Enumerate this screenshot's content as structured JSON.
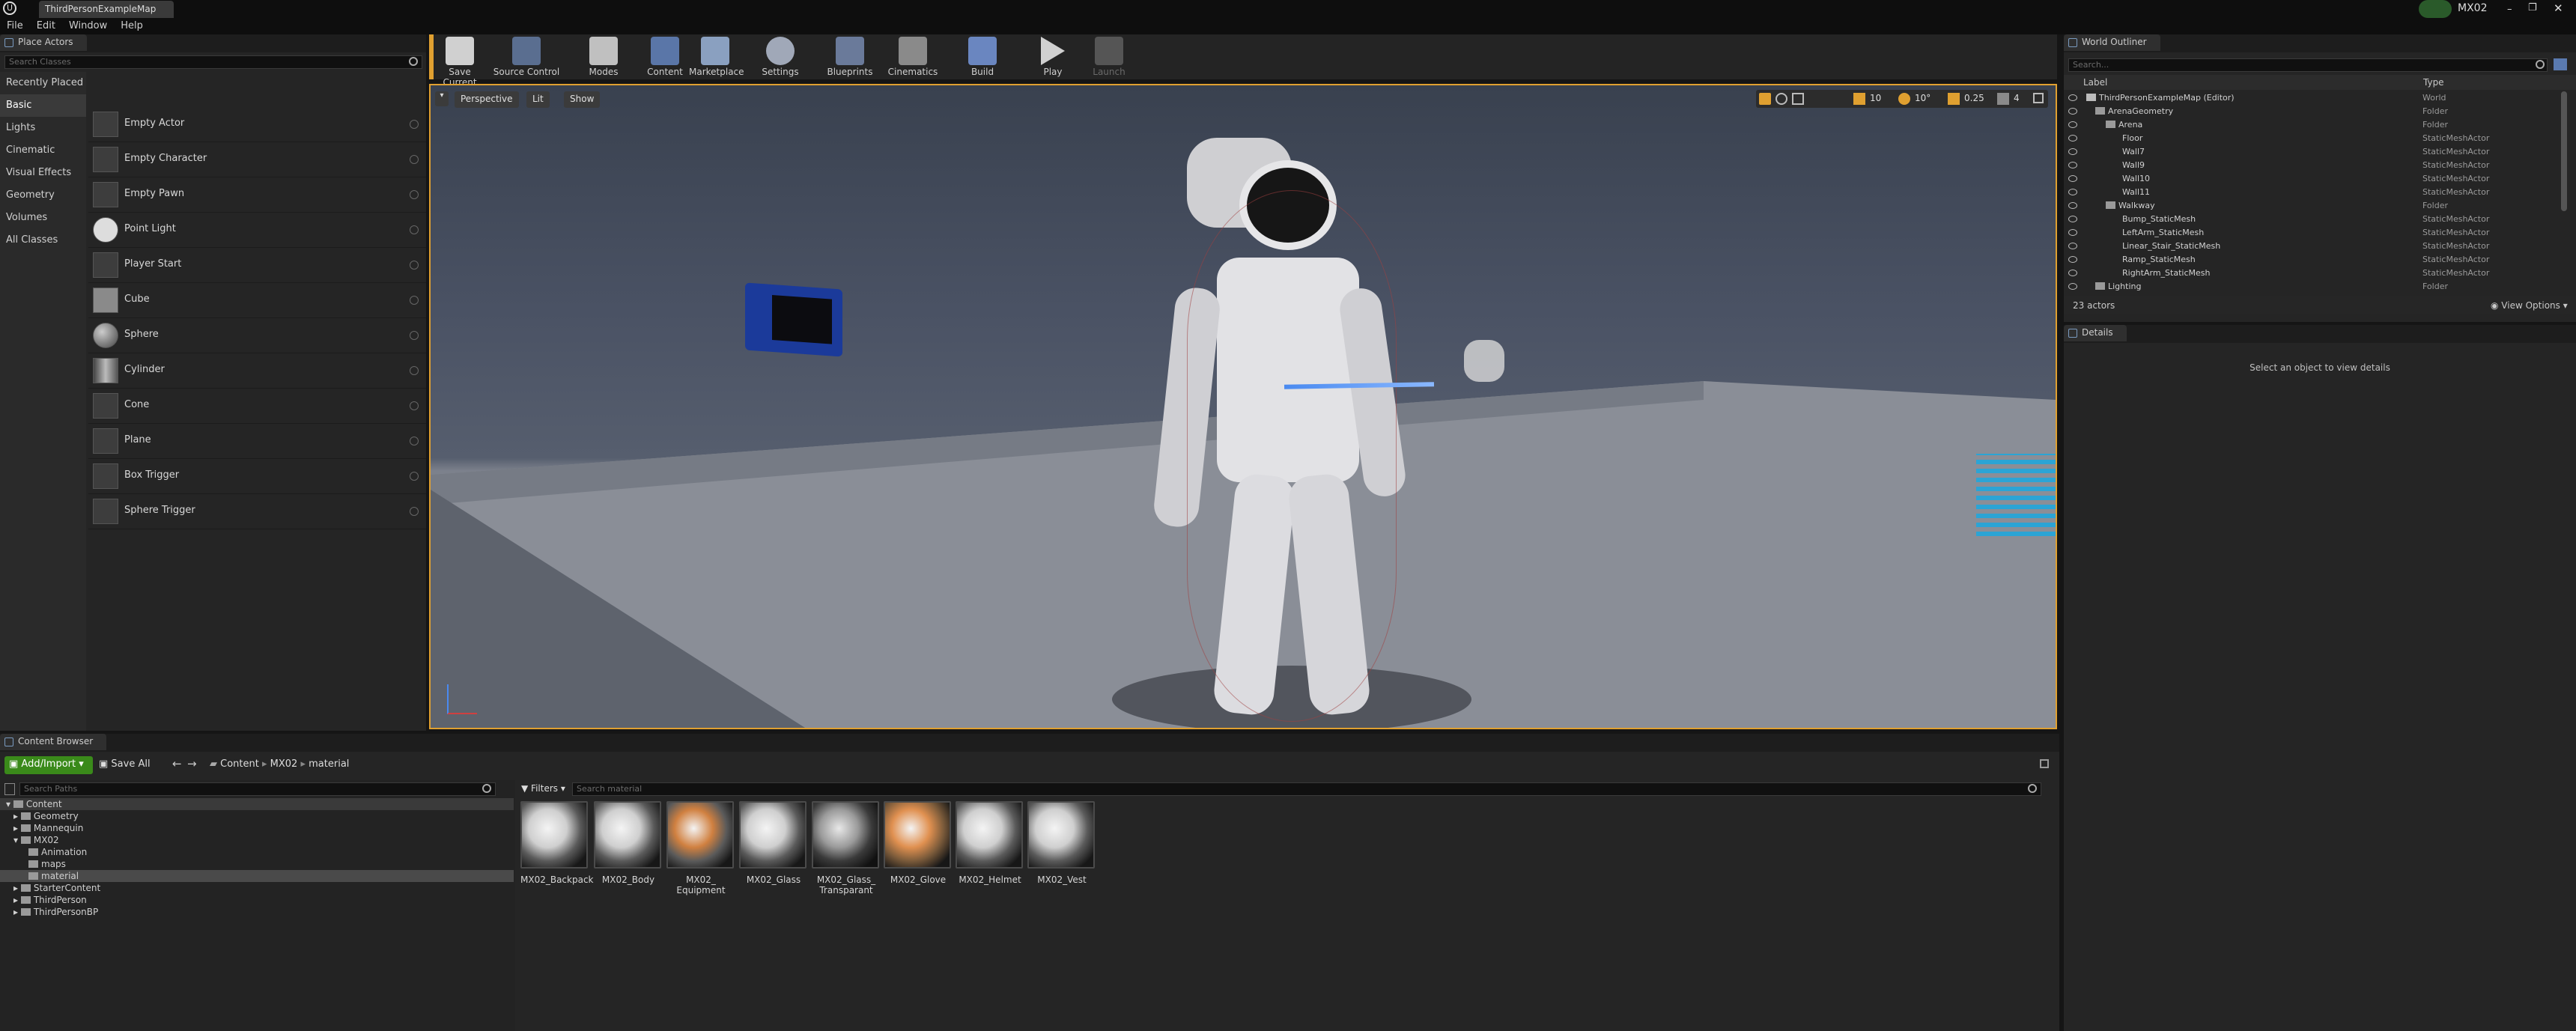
{
  "window": {
    "tab_title": "ThirdPersonExampleMap",
    "project_name": "MX02"
  },
  "menu": [
    "File",
    "Edit",
    "Window",
    "Help"
  ],
  "place_actors": {
    "tab": "Place Actors",
    "search_placeholder": "Search Classes",
    "categories": [
      "Recently Placed",
      "Basic",
      "Lights",
      "Cinematic",
      "Visual Effects",
      "Geometry",
      "Volumes",
      "All Classes"
    ],
    "selected_category": "Basic",
    "items": [
      "Empty Actor",
      "Empty Character",
      "Empty Pawn",
      "Point Light",
      "Player Start",
      "Cube",
      "Sphere",
      "Cylinder",
      "Cone",
      "Plane",
      "Box Trigger",
      "Sphere Trigger"
    ]
  },
  "toolbar": [
    {
      "label": "Save Current",
      "icon": "save-icon"
    },
    {
      "label": "Source Control",
      "icon": "source-control-icon"
    },
    {
      "label": "Modes",
      "icon": "modes-icon"
    },
    {
      "label": "Content",
      "icon": "content-icon"
    },
    {
      "label": "Marketplace",
      "icon": "marketplace-icon"
    },
    {
      "label": "Settings",
      "icon": "settings-icon"
    },
    {
      "label": "Blueprints",
      "icon": "blueprints-icon"
    },
    {
      "label": "Cinematics",
      "icon": "cinematics-icon"
    },
    {
      "label": "Build",
      "icon": "build-icon"
    },
    {
      "label": "Play",
      "icon": "play-icon"
    },
    {
      "label": "Launch",
      "icon": "launch-icon"
    }
  ],
  "viewport": {
    "perspective": "Perspective",
    "lit": "Lit",
    "show": "Show",
    "grid_snap": "10",
    "rotation_snap": "10°",
    "scale_snap": "0.25",
    "camera_speed": "4"
  },
  "outliner": {
    "tab": "World Outliner",
    "search_placeholder": "Search...",
    "col_label": "Label",
    "col_type": "Type",
    "rows": [
      {
        "label": "ThirdPersonExampleMap (Editor)",
        "type": "World",
        "depth": 0
      },
      {
        "label": "ArenaGeometry",
        "type": "Folder",
        "depth": 1
      },
      {
        "label": "Arena",
        "type": "Folder",
        "depth": 2
      },
      {
        "label": "Floor",
        "type": "StaticMeshActor",
        "depth": 3
      },
      {
        "label": "Wall7",
        "type": "StaticMeshActor",
        "depth": 3
      },
      {
        "label": "Wall9",
        "type": "StaticMeshActor",
        "depth": 3
      },
      {
        "label": "Wall10",
        "type": "StaticMeshActor",
        "depth": 3
      },
      {
        "label": "Wall11",
        "type": "StaticMeshActor",
        "depth": 3
      },
      {
        "label": "Walkway",
        "type": "Folder",
        "depth": 2
      },
      {
        "label": "Bump_StaticMesh",
        "type": "StaticMeshActor",
        "depth": 3
      },
      {
        "label": "LeftArm_StaticMesh",
        "type": "StaticMeshActor",
        "depth": 3
      },
      {
        "label": "Linear_Stair_StaticMesh",
        "type": "StaticMeshActor",
        "depth": 3
      },
      {
        "label": "Ramp_StaticMesh",
        "type": "StaticMeshActor",
        "depth": 3
      },
      {
        "label": "RightArm_StaticMesh",
        "type": "StaticMeshActor",
        "depth": 3
      },
      {
        "label": "Lighting",
        "type": "Folder",
        "depth": 1
      }
    ],
    "count": "23 actors",
    "view_options": "View Options"
  },
  "details": {
    "tab": "Details",
    "empty_text": "Select an object to view details"
  },
  "content_browser": {
    "tab": "Content Browser",
    "add_import": "Add/Import",
    "save_all": "Save All",
    "breadcrumb": [
      "Content",
      "MX02",
      "material"
    ],
    "search_paths_placeholder": "Search Paths",
    "filters": "Filters",
    "search_placeholder": "Search material",
    "tree": [
      {
        "label": "Content",
        "depth": 0
      },
      {
        "label": "Geometry",
        "depth": 1
      },
      {
        "label": "Mannequin",
        "depth": 1
      },
      {
        "label": "MX02",
        "depth": 1
      },
      {
        "label": "Animation",
        "depth": 2
      },
      {
        "label": "maps",
        "depth": 2
      },
      {
        "label": "material",
        "depth": 2
      },
      {
        "label": "StarterContent",
        "depth": 1
      },
      {
        "label": "ThirdPerson",
        "depth": 1
      },
      {
        "label": "ThirdPersonBP",
        "depth": 1
      }
    ],
    "assets": [
      "MX02_Backpack",
      "MX02_Body",
      "MX02_\nEquipment",
      "MX02_Glass",
      "MX02_Glass_\nTransparant",
      "MX02_Glove",
      "MX02_Helmet",
      "MX02_Vest"
    ]
  },
  "colors": {
    "accent": "#e0a030",
    "add_import_green": "#3a8a1a",
    "selection": "#3a3a3a"
  }
}
